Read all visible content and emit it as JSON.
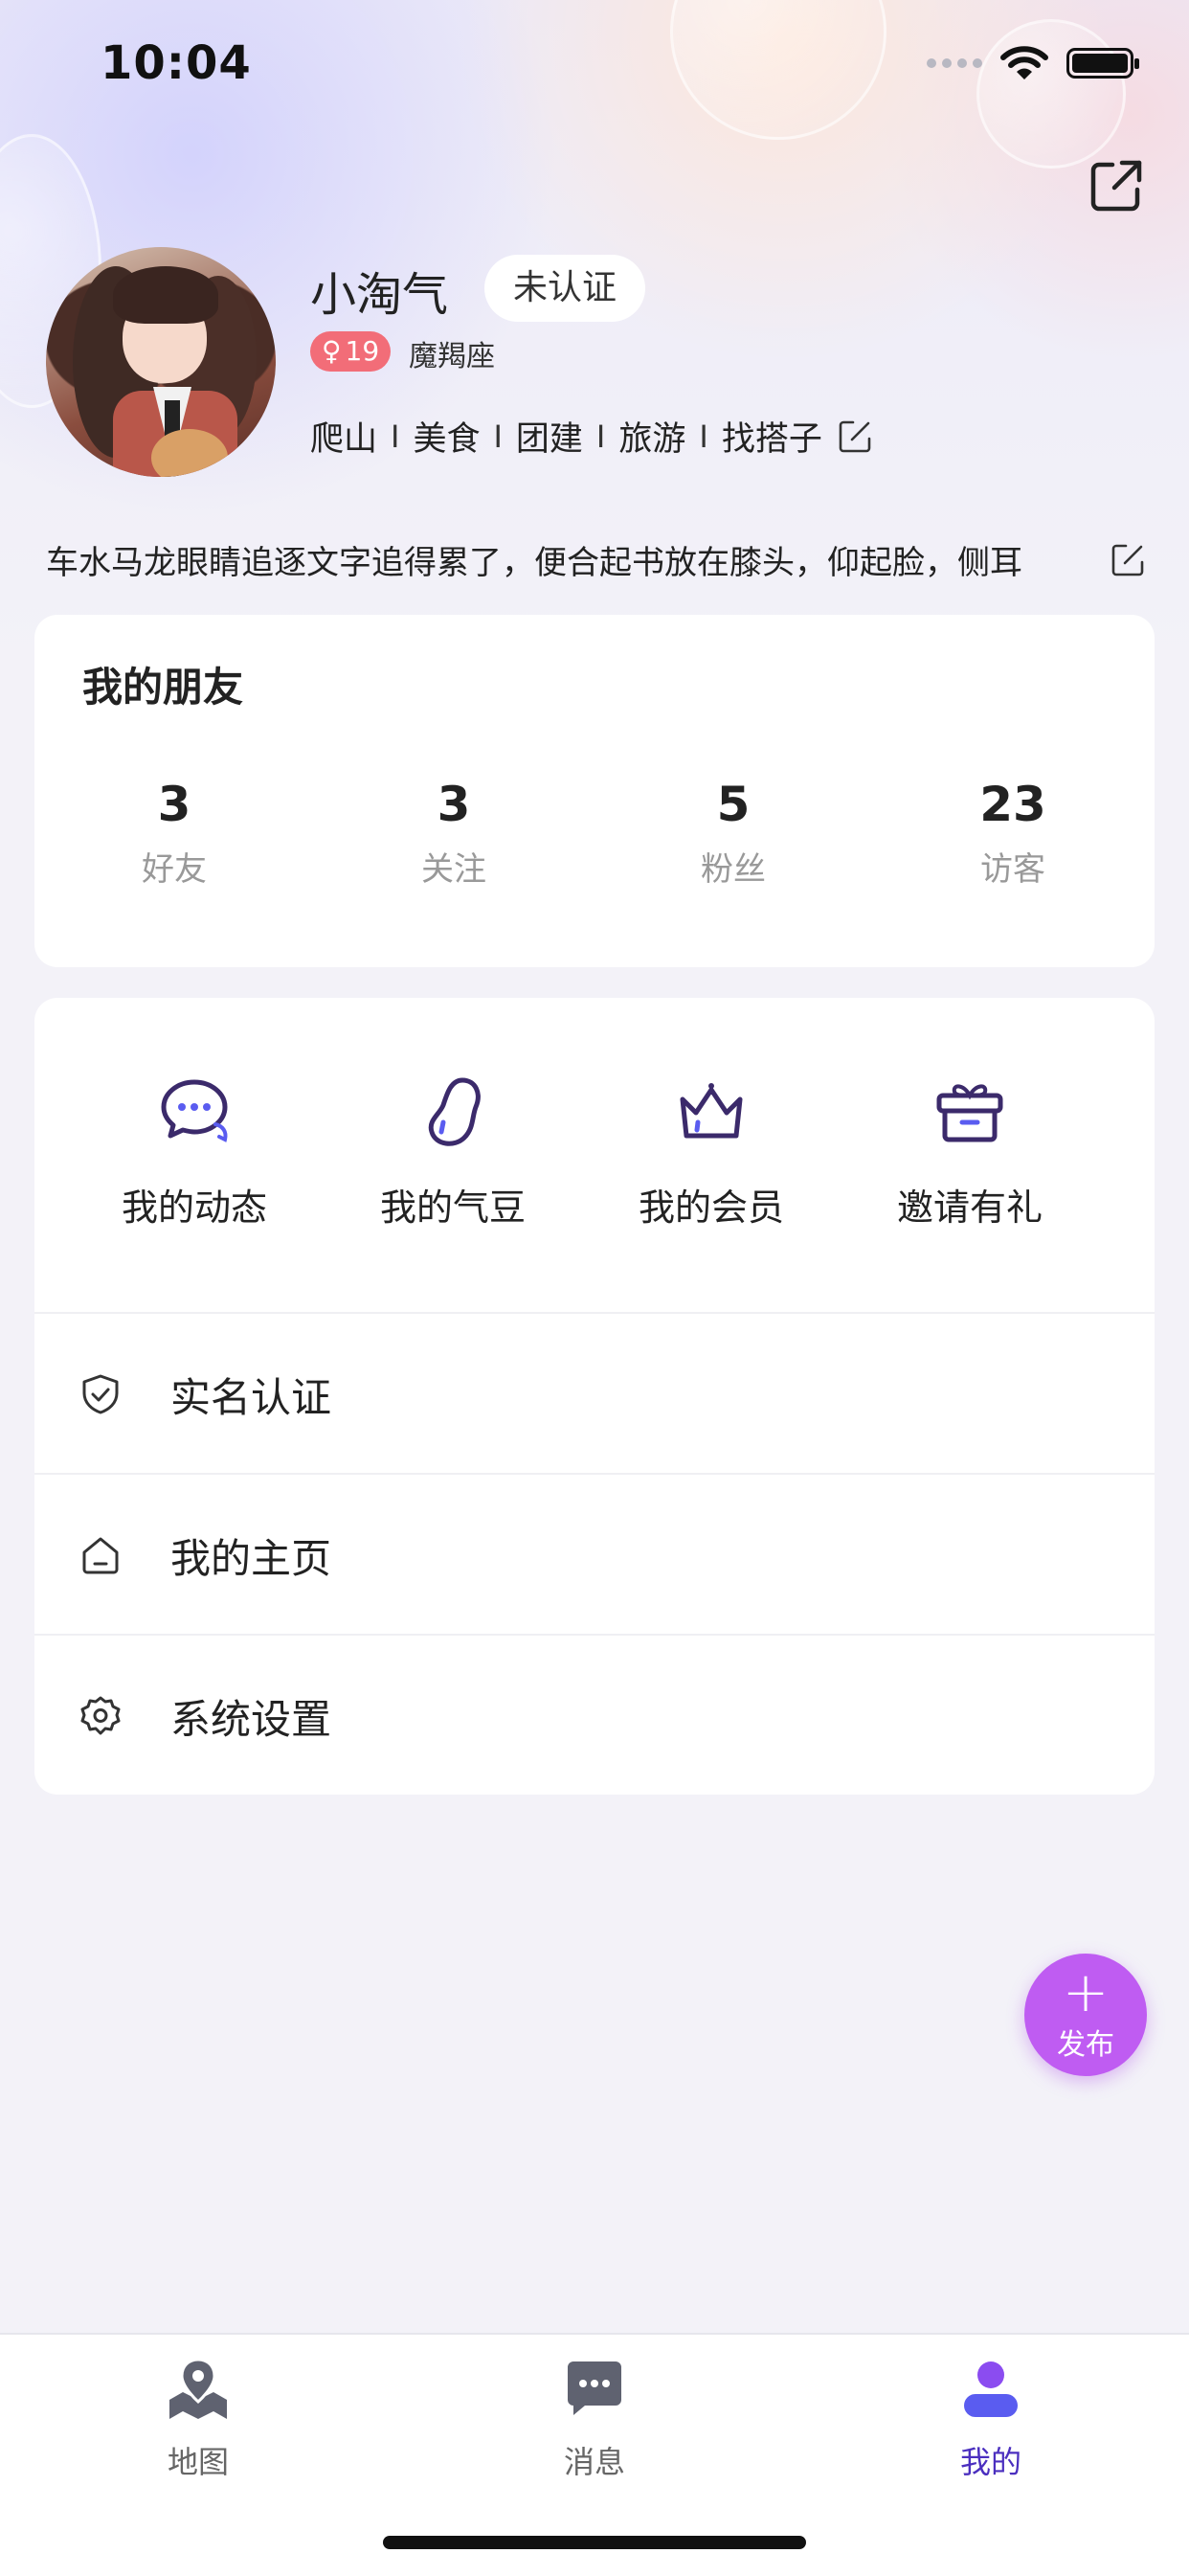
{
  "status_bar": {
    "time": "10:04",
    "icons": [
      "signal-icon",
      "wifi-icon",
      "battery-icon"
    ]
  },
  "header": {
    "share_icon": "share-icon"
  },
  "profile": {
    "nickname": "小淘气",
    "verify_status": "未认证",
    "gender_symbol": "♀",
    "age": "19",
    "zodiac": "魔羯座",
    "tags": [
      "爬山",
      "美食",
      "团建",
      "旅游",
      "找搭子"
    ],
    "tag_separator": "I",
    "bio": "车水马龙眼睛追逐文字追得累了，便合起书放在膝头，仰起脸，侧耳"
  },
  "friends": {
    "title": "我的朋友",
    "stats": [
      {
        "value": "3",
        "label": "好友"
      },
      {
        "value": "3",
        "label": "关注"
      },
      {
        "value": "5",
        "label": "粉丝"
      },
      {
        "value": "23",
        "label": "访客"
      }
    ]
  },
  "quick_actions": [
    {
      "label": "我的动态",
      "icon": "chat-bubble-icon"
    },
    {
      "label": "我的气豆",
      "icon": "bean-icon"
    },
    {
      "label": "我的会员",
      "icon": "crown-icon"
    },
    {
      "label": "邀请有礼",
      "icon": "gift-icon"
    }
  ],
  "menu": [
    {
      "label": "实名认证",
      "icon": "shield-check-icon"
    },
    {
      "label": "我的主页",
      "icon": "home-icon"
    },
    {
      "label": "系统设置",
      "icon": "gear-icon"
    }
  ],
  "fab": {
    "label": "发布",
    "icon": "plus-icon"
  },
  "tabbar": {
    "tabs": [
      {
        "label": "地图",
        "icon": "map-pin-icon",
        "active": false
      },
      {
        "label": "消息",
        "icon": "message-icon",
        "active": false
      },
      {
        "label": "我的",
        "icon": "person-icon",
        "active": true
      }
    ]
  },
  "colors": {
    "accent": "#4b2fbf",
    "fab": "#bf5cf2",
    "gender_badge": "#f26d78",
    "page_bg": "#f3f2f8",
    "icon_primary": "#3b2a6b",
    "icon_secondary": "#5a5cf0"
  }
}
